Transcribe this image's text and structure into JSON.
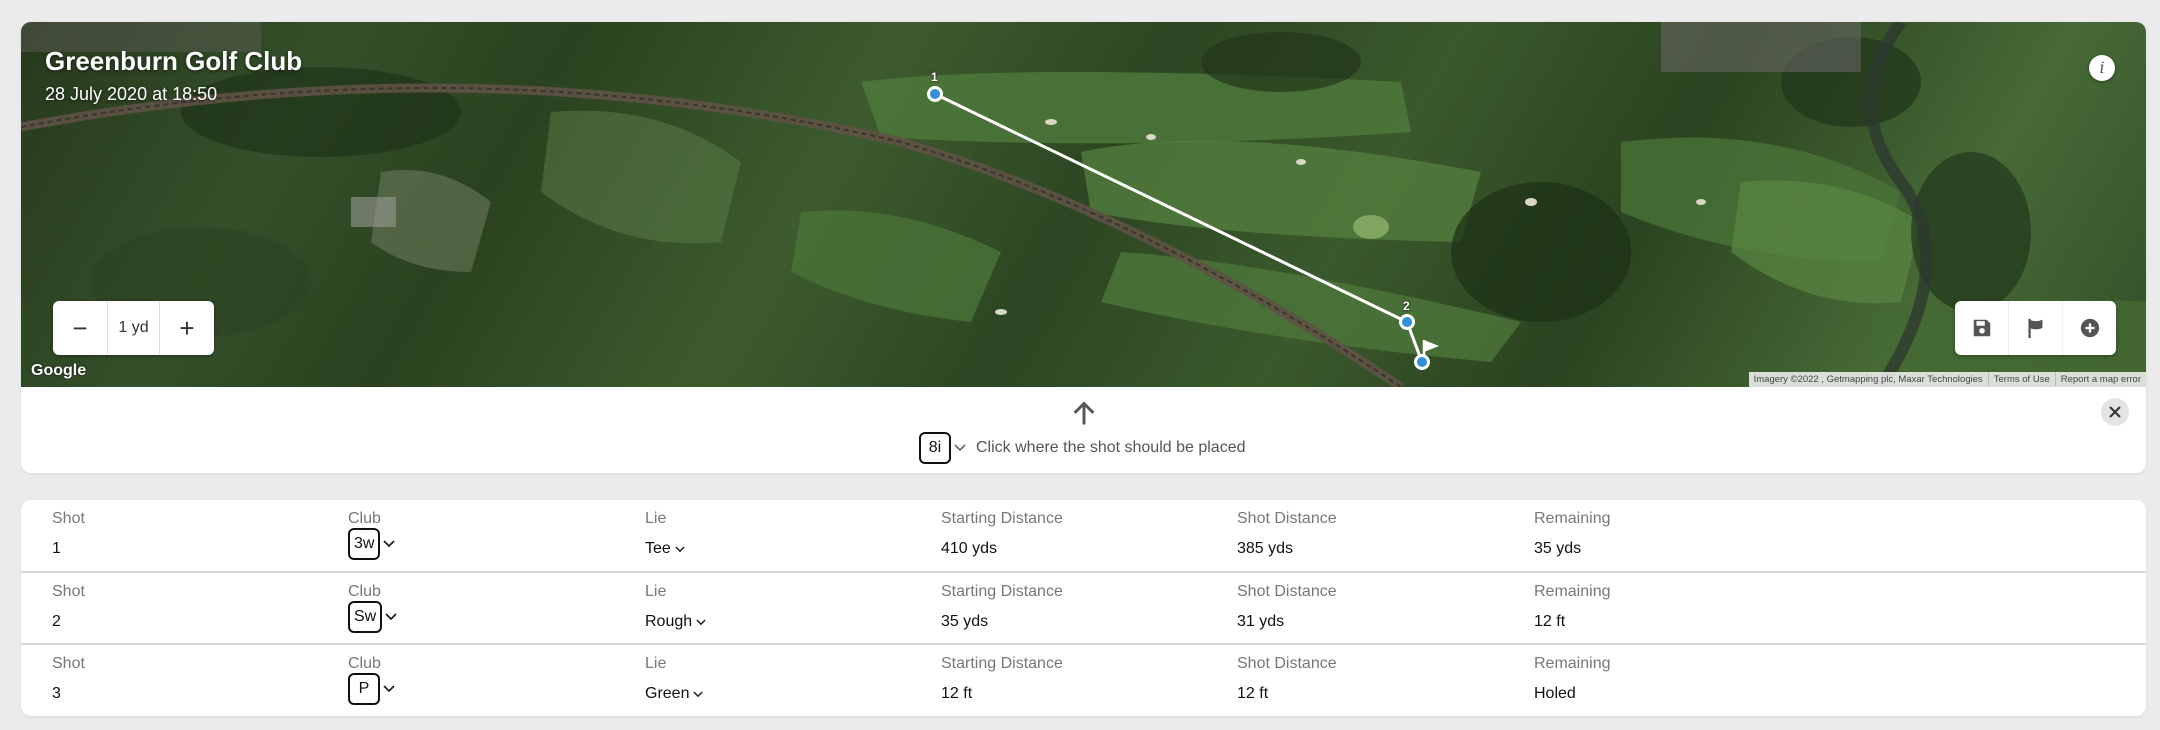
{
  "course": {
    "name": "Greenburn Golf Club",
    "date": "28 July 2020 at 18:50"
  },
  "map": {
    "zoom_out_label": "−",
    "zoom_value": "1 yd",
    "zoom_in_label": "+",
    "info_label": "i",
    "google_logo": "Google",
    "attribution": {
      "imagery": "Imagery ©2022 , Getmapping plc, Maxar Technologies",
      "terms": "Terms of Use",
      "report": "Report a map error"
    },
    "shot_markers": [
      {
        "label": "1"
      },
      {
        "label": "2"
      }
    ],
    "tools": [
      {
        "icon": "save-icon"
      },
      {
        "icon": "flag-icon"
      },
      {
        "icon": "add-circle-icon"
      }
    ]
  },
  "placement": {
    "club": "8i",
    "instruction": "Click where the shot should be placed"
  },
  "table": {
    "headers": {
      "shot": "Shot",
      "club": "Club",
      "lie": "Lie",
      "start": "Starting Distance",
      "shot_distance": "Shot Distance",
      "remaining": "Remaining"
    },
    "rows": [
      {
        "shot": "1",
        "club": "3w",
        "lie": "Tee",
        "start": "410 yds",
        "shot_distance": "385 yds",
        "remaining": "35 yds"
      },
      {
        "shot": "2",
        "club": "Sw",
        "lie": "Rough",
        "start": "35 yds",
        "shot_distance": "31 yds",
        "remaining": "12 ft"
      },
      {
        "shot": "3",
        "club": "P",
        "lie": "Green",
        "start": "12 ft",
        "shot_distance": "12 ft",
        "remaining": "Holed"
      }
    ]
  },
  "colors": {
    "accent": "#2f90d8",
    "shot_line": "#ffffff"
  }
}
